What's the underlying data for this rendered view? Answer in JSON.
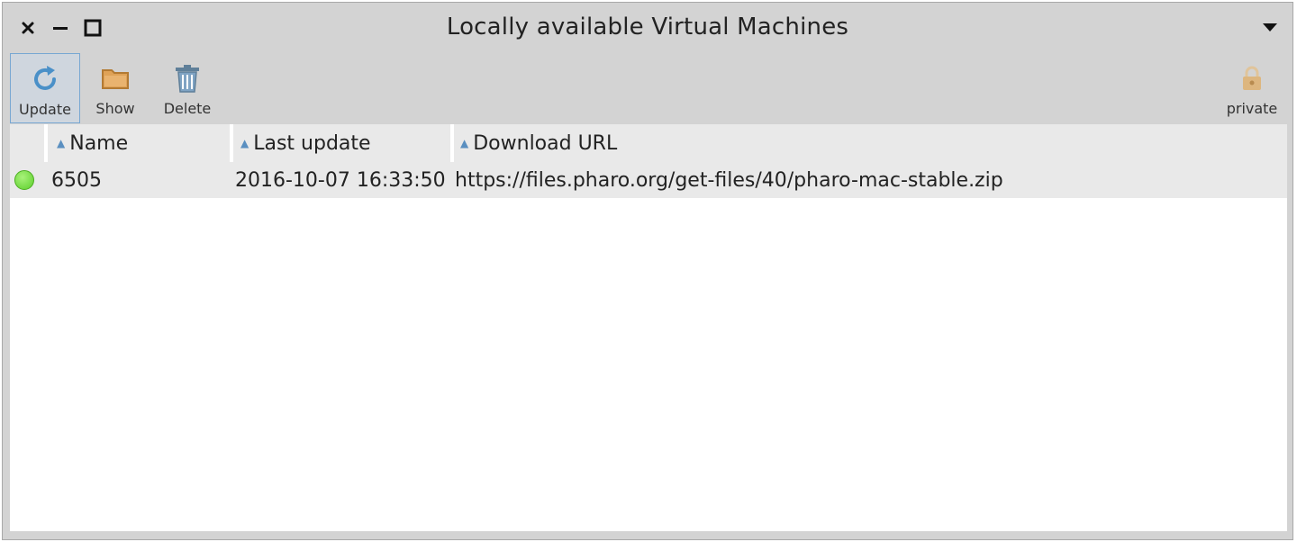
{
  "window": {
    "title": "Locally available Virtual Machines",
    "controls": [
      "close-icon",
      "minimize-icon",
      "maximize-icon"
    ],
    "menu_icon": "chevron-down-icon"
  },
  "toolbar": {
    "update_label": "Update",
    "show_label": "Show",
    "delete_label": "Delete",
    "private_label": "private",
    "accent": "#4a90c8"
  },
  "table": {
    "columns": [
      "Name",
      "Last update",
      "Download URL"
    ],
    "rows": [
      {
        "status": "green",
        "name": "6505",
        "last_update": "2016-10-07 16:33:50",
        "url": "https://files.pharo.org/get-files/40/pharo-mac-stable.zip"
      }
    ]
  }
}
